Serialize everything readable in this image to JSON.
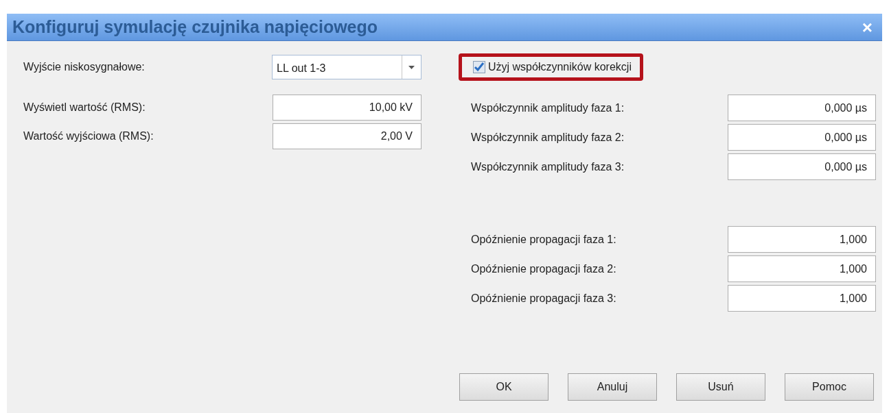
{
  "window": {
    "title": "Konfiguruj symulację czujnika napięciowego",
    "close": "×"
  },
  "left_fields": [
    {
      "kind": "combo",
      "label": "Wyjście niskosygnałowe:",
      "value": "LL out 1-3"
    },
    {
      "kind": "text",
      "label": "Wyświetl wartość (RMS):",
      "value": "10,00 kV"
    },
    {
      "kind": "text",
      "label": "Wartość wyjściowa (RMS):",
      "value": "2,00 V"
    }
  ],
  "correction_checkbox": {
    "label": "Użyj współczynników korekcji",
    "checked": true,
    "highlighted": true
  },
  "amplitude_fields": [
    {
      "label": "Współczynnik amplitudy faza 1:",
      "value": "0,000 µs"
    },
    {
      "label": "Współczynnik amplitudy faza 2:",
      "value": "0,000 µs"
    },
    {
      "label": "Współczynnik amplitudy faza 3:",
      "value": "0,000 µs"
    }
  ],
  "delay_fields": [
    {
      "label": "Opóźnienie propagacji faza 1:",
      "value": "1,000"
    },
    {
      "label": "Opóźnienie propagacji faza 2:",
      "value": "1,000"
    },
    {
      "label": "Opóźnienie propagacji faza 3:",
      "value": "1,000"
    }
  ],
  "buttons": [
    "OK",
    "Anuluj",
    "Usuń",
    "Pomoc"
  ]
}
